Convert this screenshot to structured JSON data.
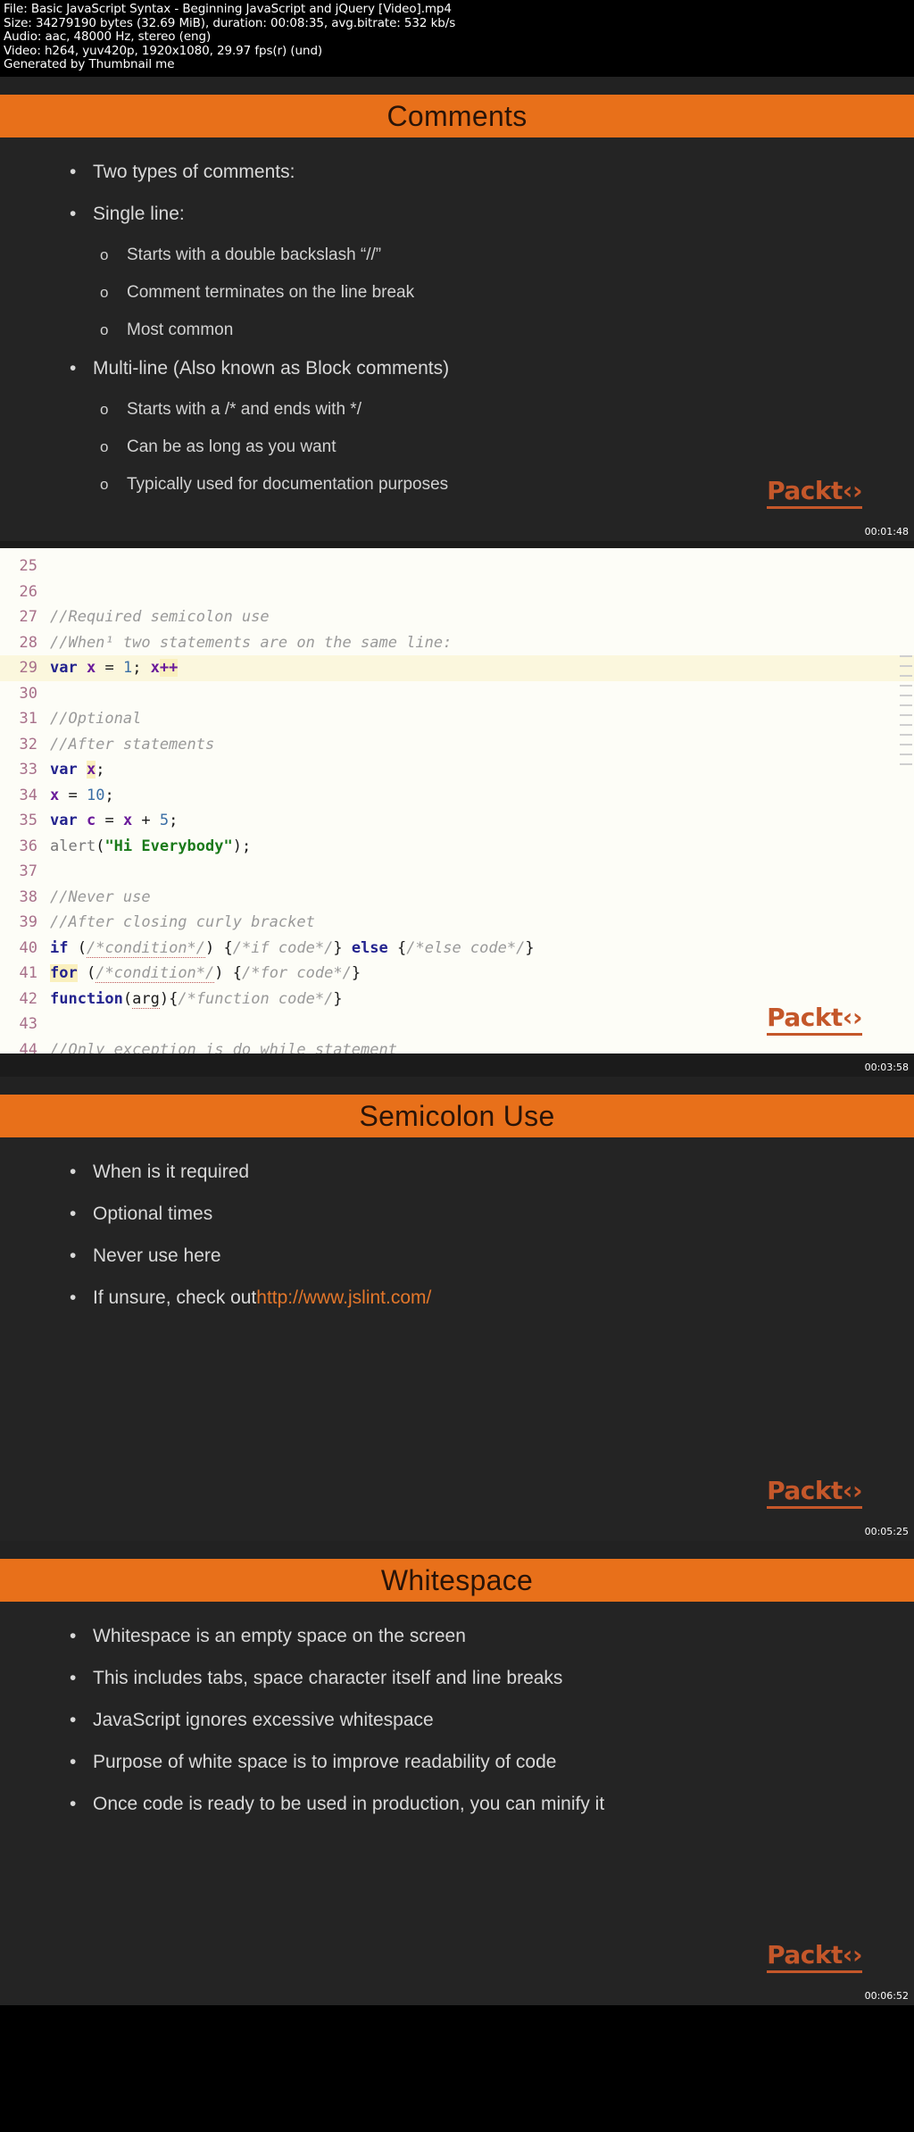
{
  "fileinfo": {
    "line1": "File: Basic JavaScript Syntax - Beginning JavaScript and jQuery [Video].mp4",
    "line2": "Size: 34279190 bytes (32.69 MiB), duration: 00:08:35, avg.bitrate: 532 kb/s",
    "line3": "Audio: aac, 48000 Hz, stereo (eng)",
    "line4": "Video: h264, yuv420p, 1920x1080, 29.97 fps(r) (und)",
    "line5": "Generated by Thumbnail me"
  },
  "colors": {
    "accent_orange": "#e8701a",
    "slide_bg": "#242424",
    "packt_orange": "#c4572a",
    "link_orange": "#e2762a"
  },
  "brand": {
    "logo_text": "Packt",
    "logo_glyph": "icon"
  },
  "thumbs": [
    {
      "kind": "slide",
      "title": "Comments",
      "timestamp": "00:01:48",
      "bullets": [
        {
          "level": 1,
          "marker": "•",
          "text": "Two types of comments:"
        },
        {
          "level": 1,
          "marker": "•",
          "text": "Single line:"
        },
        {
          "level": 2,
          "marker": "o",
          "text": "Starts with a double backslash “//”"
        },
        {
          "level": 2,
          "marker": "o",
          "text": "Comment terminates on the line break"
        },
        {
          "level": 2,
          "marker": "o",
          "text": "Most common"
        },
        {
          "level": 1,
          "marker": "•",
          "text": "Multi-line (Also known as Block comments)"
        },
        {
          "level": 2,
          "marker": "o",
          "text": "Starts with a /* and ends with */"
        },
        {
          "level": 2,
          "marker": "o",
          "text": "Can be as long as you want"
        },
        {
          "level": 2,
          "marker": "o",
          "text": "Typically used for documentation purposes"
        }
      ]
    },
    {
      "kind": "editor",
      "timestamp": "00:03:58",
      "lines": [
        {
          "n": "25",
          "highlight": false,
          "tokens": []
        },
        {
          "n": "26",
          "highlight": false,
          "tokens": []
        },
        {
          "n": "27",
          "highlight": false,
          "tokens": [
            {
              "t": "cmt",
              "s": "//Required semicolon use"
            }
          ]
        },
        {
          "n": "28",
          "highlight": false,
          "tokens": [
            {
              "t": "cmt",
              "s": "//When¹ two statements are on the same line:"
            }
          ]
        },
        {
          "n": "29",
          "highlight": true,
          "tokens": [
            {
              "t": "kw",
              "s": "var"
            },
            {
              "t": "code",
              "s": " "
            },
            {
              "t": "var",
              "s": "x"
            },
            {
              "t": "code",
              "s": " = "
            },
            {
              "t": "num",
              "s": "1"
            },
            {
              "t": "code",
              "s": "; "
            },
            {
              "t": "var",
              "s": "x"
            },
            {
              "t": "mark",
              "s": "++"
            }
          ]
        },
        {
          "n": "30",
          "highlight": false,
          "tokens": []
        },
        {
          "n": "31",
          "highlight": false,
          "tokens": [
            {
              "t": "cmt",
              "s": "//Optional"
            }
          ]
        },
        {
          "n": "32",
          "highlight": false,
          "tokens": [
            {
              "t": "cmt",
              "s": "//After statements"
            }
          ]
        },
        {
          "n": "33",
          "highlight": false,
          "tokens": [
            {
              "t": "kw",
              "s": "var"
            },
            {
              "t": "code",
              "s": " "
            },
            {
              "t": "varmark",
              "s": "x"
            },
            {
              "t": "code",
              "s": ";"
            }
          ]
        },
        {
          "n": "34",
          "highlight": false,
          "tokens": [
            {
              "t": "var",
              "s": "x"
            },
            {
              "t": "code",
              "s": " = "
            },
            {
              "t": "num",
              "s": "10"
            },
            {
              "t": "code",
              "s": ";"
            }
          ]
        },
        {
          "n": "35",
          "highlight": false,
          "tokens": [
            {
              "t": "kw",
              "s": "var"
            },
            {
              "t": "code",
              "s": " "
            },
            {
              "t": "var",
              "s": "c"
            },
            {
              "t": "code",
              "s": " = "
            },
            {
              "t": "var",
              "s": "x"
            },
            {
              "t": "code",
              "s": " + "
            },
            {
              "t": "num",
              "s": "5"
            },
            {
              "t": "code",
              "s": ";"
            }
          ]
        },
        {
          "n": "36",
          "highlight": false,
          "tokens": [
            {
              "t": "fn",
              "s": "alert"
            },
            {
              "t": "code",
              "s": "("
            },
            {
              "t": "str",
              "s": "\"Hi Everybody\""
            },
            {
              "t": "code",
              "s": ");"
            }
          ]
        },
        {
          "n": "37",
          "highlight": false,
          "tokens": []
        },
        {
          "n": "38",
          "highlight": false,
          "tokens": [
            {
              "t": "cmt",
              "s": "//Never use"
            }
          ]
        },
        {
          "n": "39",
          "highlight": false,
          "tokens": [
            {
              "t": "cmt",
              "s": "//After closing curly bracket"
            }
          ]
        },
        {
          "n": "40",
          "highlight": false,
          "tokens": [
            {
              "t": "kw",
              "s": "if"
            },
            {
              "t": "code",
              "s": " ("
            },
            {
              "t": "cmtu",
              "s": "/*condition*/"
            },
            {
              "t": "code",
              "s": ") {"
            },
            {
              "t": "cmt",
              "s": "/*if code*/"
            },
            {
              "t": "code",
              "s": "} "
            },
            {
              "t": "kw",
              "s": "else"
            },
            {
              "t": "code",
              "s": " {"
            },
            {
              "t": "cmt",
              "s": "/*else code*/"
            },
            {
              "t": "code",
              "s": "}"
            }
          ]
        },
        {
          "n": "41",
          "highlight": false,
          "tokens": [
            {
              "t": "kwmark",
              "s": "for"
            },
            {
              "t": "code",
              "s": " ("
            },
            {
              "t": "cmtu",
              "s": "/*condition*/"
            },
            {
              "t": "code",
              "s": ") {"
            },
            {
              "t": "cmt",
              "s": "/*for code*/"
            },
            {
              "t": "code",
              "s": "}"
            }
          ]
        },
        {
          "n": "42",
          "highlight": false,
          "tokens": [
            {
              "t": "kw",
              "s": "function"
            },
            {
              "t": "code",
              "s": "("
            },
            {
              "t": "codeu",
              "s": "arg"
            },
            {
              "t": "code",
              "s": "){"
            },
            {
              "t": "cmt",
              "s": "/*function code*/"
            },
            {
              "t": "code",
              "s": "}"
            }
          ]
        },
        {
          "n": "43",
          "highlight": false,
          "tokens": []
        },
        {
          "n": "44",
          "highlight": false,
          "tokens": [
            {
              "t": "cmt",
              "s": "//Only exception is do while statement"
            }
          ]
        }
      ]
    },
    {
      "kind": "slide",
      "title": "Semicolon Use",
      "timestamp": "00:05:25",
      "bullets": [
        {
          "level": 1,
          "marker": "•",
          "text": "When is it required"
        },
        {
          "level": 1,
          "marker": "•",
          "text": "Optional times"
        },
        {
          "level": 1,
          "marker": "•",
          "text": "Never use here"
        },
        {
          "level": 1,
          "marker": "•",
          "text": "If unsure, check out ",
          "link": "http://www.jslint.com/"
        }
      ]
    },
    {
      "kind": "slide",
      "title": "Whitespace",
      "timestamp": "00:06:52",
      "bullets": [
        {
          "level": 1,
          "marker": "•",
          "text": "Whitespace is an empty space on the screen"
        },
        {
          "level": 1,
          "marker": "•",
          "text": "This includes tabs, space character itself and line breaks"
        },
        {
          "level": 1,
          "marker": "•",
          "text": "JavaScript ignores excessive whitespace"
        },
        {
          "level": 1,
          "marker": "•",
          "text": "Purpose of white space is to improve readability of code"
        },
        {
          "level": 1,
          "marker": "•",
          "text": "Once code is ready to be used in production, you can minify it"
        }
      ]
    }
  ]
}
